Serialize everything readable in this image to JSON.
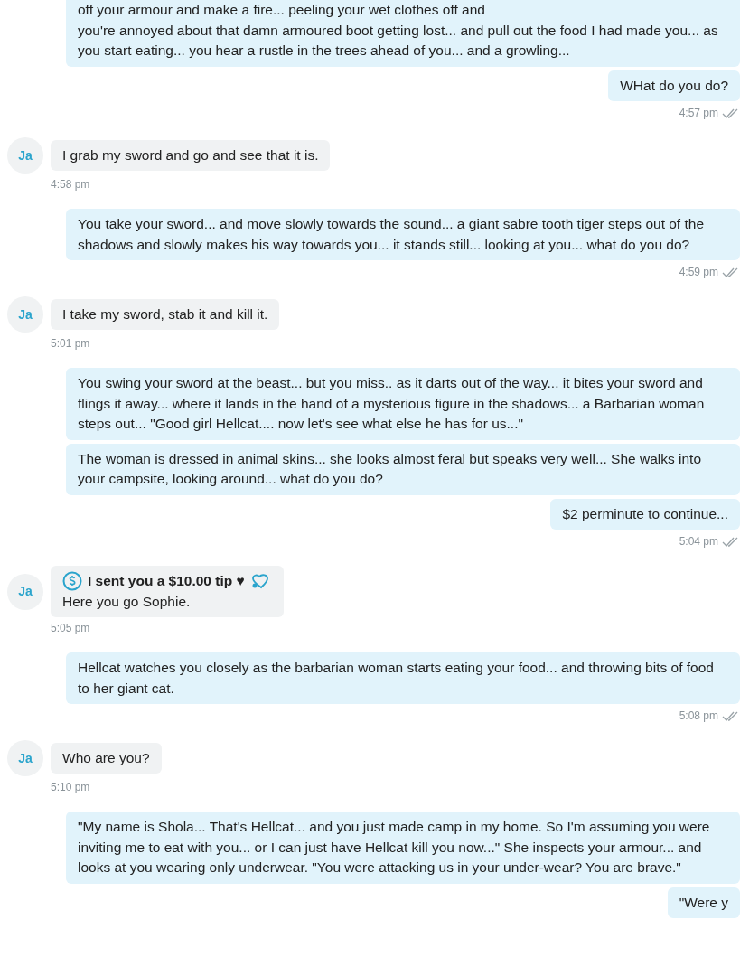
{
  "messages": [
    {
      "kind": "out",
      "bubbles": [
        "off your armour and make a fire... peeling your wet clothes off and",
        "you're annoyed about that damn armoured boot getting lost... and pull out the food I had made you... as you start eating... you hear a rustle in the trees ahead of you... and a growling...",
        "WHat do you do?"
      ],
      "time": "4:57 pm",
      "read": true
    },
    {
      "kind": "in",
      "initials": "Ja",
      "bubbles": [
        "I grab my sword and go and see that it is."
      ],
      "time": "4:58 pm"
    },
    {
      "kind": "out",
      "bubbles": [
        "You take your sword... and move slowly towards the sound... a giant sabre tooth tiger steps out of the shadows and slowly makes his way towards you... it stands still... looking at you... what do you do?"
      ],
      "time": "4:59 pm",
      "read": true
    },
    {
      "kind": "in",
      "initials": "Ja",
      "bubbles": [
        "I take my sword, stab it and kill it."
      ],
      "time": "5:01 pm"
    },
    {
      "kind": "out",
      "bubbles": [
        "You swing your sword at the beast... but you miss.. as it darts out of the way... it bites your sword and flings it away... where it lands in the hand of a mysterious figure in the shadows... a Barbarian woman steps out... \"Good girl Hellcat.... now let's see what else he has for us...\"",
        "The woman is dressed in animal skins... she looks almost feral but speaks very well... She walks into your campsite, looking around... what do you do?",
        "$2 perminute to continue..."
      ],
      "time": "5:04 pm",
      "read": true
    },
    {
      "kind": "in",
      "initials": "Ja",
      "tip": "I sent you a $10.00 tip ♥",
      "bubbles": [
        "Here you go Sophie."
      ],
      "time": "5:05 pm"
    },
    {
      "kind": "out",
      "bubbles": [
        "Hellcat watches you closely as the barbarian woman starts eating your food... and throwing bits of food to her giant cat."
      ],
      "time": "5:08 pm",
      "read": true
    },
    {
      "kind": "in",
      "initials": "Ja",
      "bubbles": [
        "Who are you?"
      ],
      "time": "5:10 pm"
    },
    {
      "kind": "out",
      "bubbles": [
        "\"My name is Shola... That's Hellcat... and you just made camp in my home. So I'm assuming you were inviting me to eat with you... or I can just have Hellcat kill you now...\" She inspects your armour... and looks at you wearing only underwear. \"You were attacking us in your under-wear? You are brave.\"",
        "\"Were y"
      ]
    }
  ]
}
